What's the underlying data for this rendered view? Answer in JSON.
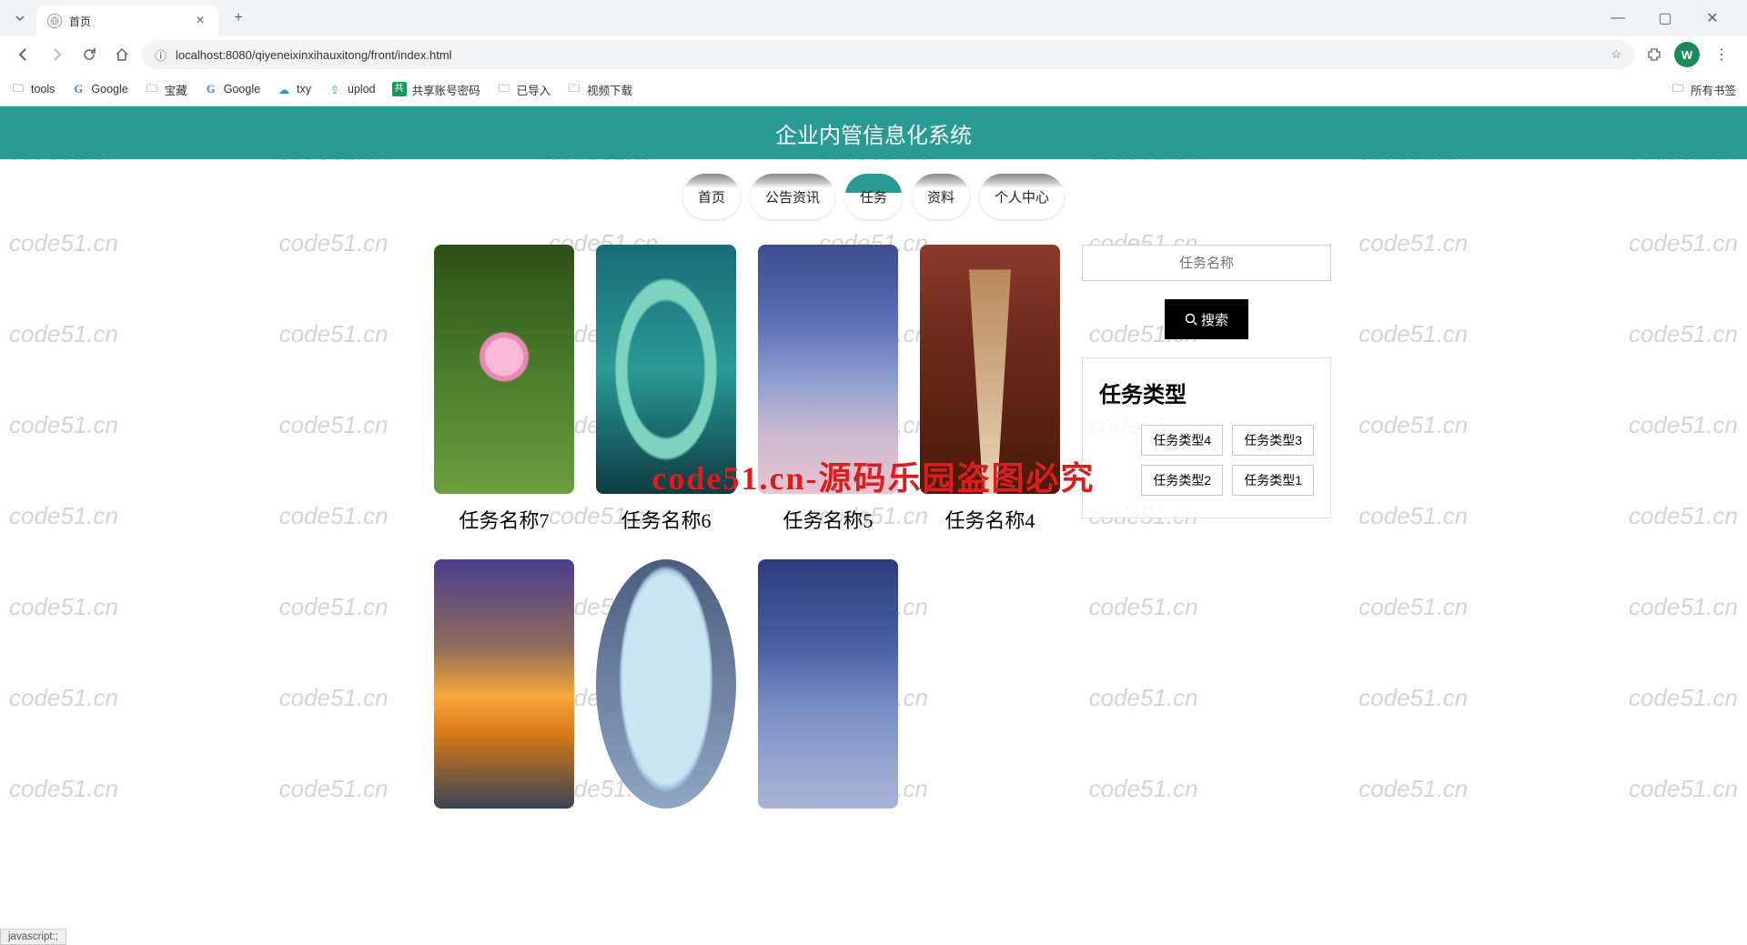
{
  "browser": {
    "tab_title": "首页",
    "url": "localhost:8080/qiyeneixinxihauxitong/front/index.html",
    "avatar_letter": "W",
    "status_text": "javascript:;"
  },
  "bookmarks": {
    "items": [
      "tools",
      "Google",
      "宝藏",
      "Google",
      "txy",
      "uplod",
      "共享账号密码",
      "已导入",
      "视频下载"
    ],
    "all": "所有书签"
  },
  "banner_title": "企业内管信息化系统",
  "nav": [
    "首页",
    "公告资讯",
    "任务",
    "资料",
    "个人中心"
  ],
  "cards": [
    {
      "title": "任务名称7"
    },
    {
      "title": "任务名称6"
    },
    {
      "title": "任务名称5"
    },
    {
      "title": "任务名称4"
    },
    {
      "title": ""
    },
    {
      "title": ""
    },
    {
      "title": ""
    }
  ],
  "search": {
    "placeholder": "任务名称",
    "button": "搜索"
  },
  "category": {
    "title": "任务类型",
    "tags": [
      "任务类型4",
      "任务类型3",
      "任务类型2",
      "任务类型1"
    ]
  },
  "watermark": "code51.cn",
  "overlay": "code51.cn-源码乐园盗图必究"
}
